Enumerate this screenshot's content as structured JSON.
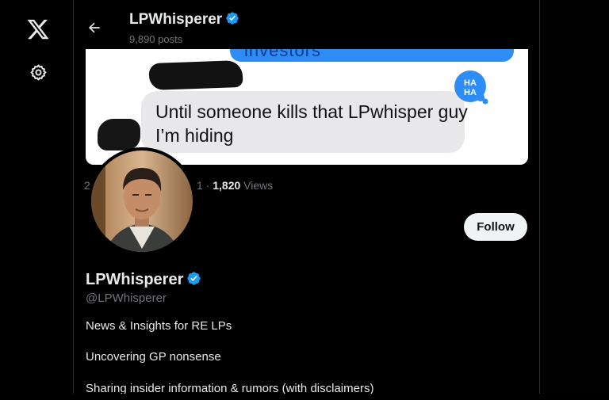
{
  "header": {
    "name": "LPWhisperer",
    "posts": "9,890 posts"
  },
  "banner": {
    "sent_message_fragment": "investors",
    "received_message": "Until someone kills that LPwhisper guy I’m hiding",
    "reaction": "HAHA"
  },
  "meta": {
    "left_fragment": "2",
    "views_prefix": "1 · ",
    "views_count": "1,820",
    "views_label": " Views"
  },
  "profile": {
    "name": "LPWhisperer",
    "handle": "@LPWhisperer",
    "follow_label": "Follow",
    "bio": [
      "News & Insights for RE LPs",
      "Uncovering GP nonsense",
      "Sharing insider information & rumors (with disclaimers)"
    ]
  },
  "colors": {
    "background": "#000000",
    "verified": "#1d9bf0",
    "imessage_blue": "#2d8cf6",
    "muted_text": "#71767b"
  },
  "icons": {
    "logo": "x-logo-icon",
    "settings": "gear-icon",
    "back": "arrow-left-icon",
    "verified": "verified-badge-icon"
  }
}
